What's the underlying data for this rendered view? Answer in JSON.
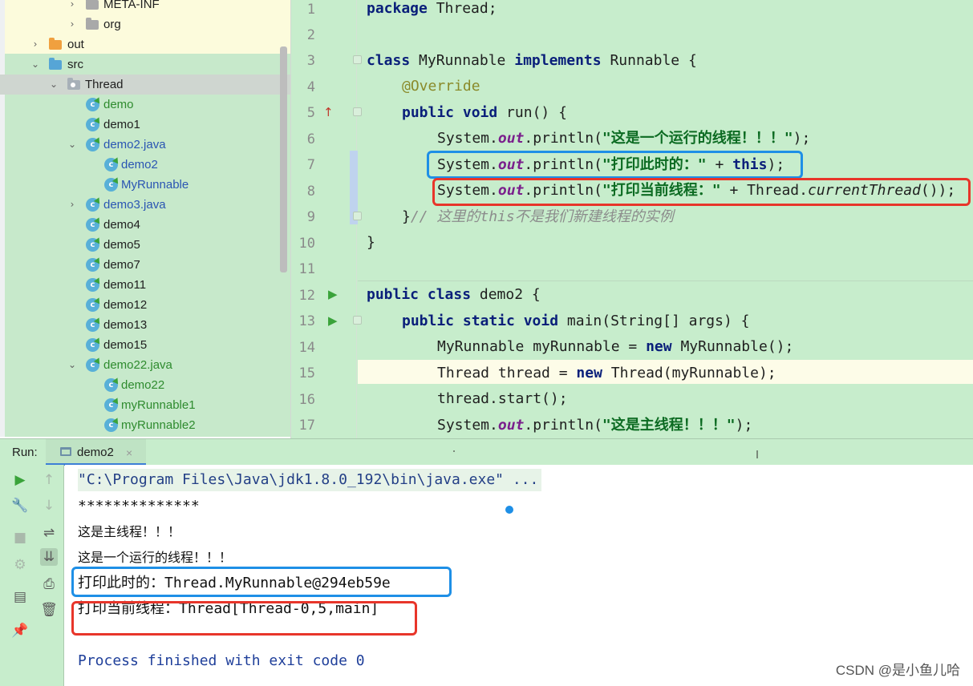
{
  "tree": {
    "items": [
      {
        "label": "META-INF",
        "chevron": "›"
      },
      {
        "label": "org",
        "chevron": "›"
      },
      {
        "label": "out",
        "chevron": "›"
      },
      {
        "label": "src",
        "chevron": "⌄"
      },
      {
        "label": "Thread",
        "chevron": "⌄"
      },
      {
        "label": "demo"
      },
      {
        "label": "demo1"
      },
      {
        "label": "demo2.java",
        "chevron": "⌄"
      },
      {
        "label": "demo2"
      },
      {
        "label": "MyRunnable"
      },
      {
        "label": "demo3.java",
        "chevron": "›"
      },
      {
        "label": "demo4"
      },
      {
        "label": "demo5"
      },
      {
        "label": "demo7"
      },
      {
        "label": "demo11"
      },
      {
        "label": "demo12"
      },
      {
        "label": "demo13"
      },
      {
        "label": "demo15"
      },
      {
        "label": "demo22.java",
        "chevron": "⌄"
      },
      {
        "label": "demo22"
      },
      {
        "label": "myRunnable1"
      },
      {
        "label": "myRunnable2"
      }
    ],
    "class_icon_letter": "c"
  },
  "editor": {
    "line_numbers": [
      "1",
      "2",
      "3",
      "4",
      "5",
      "6",
      "7",
      "8",
      "9",
      "10",
      "11",
      "12",
      "13",
      "14",
      "15",
      "16",
      "17"
    ],
    "code": {
      "l1_kw": "package",
      "l1_rest": " Thread;",
      "l3_kw1": "class",
      "l3_name": " MyRunnable ",
      "l3_kw2": "implements",
      "l3_rest": " Runnable {",
      "l4_ann": "@Override",
      "l5_kw": "public void",
      "l5_rest": " run() {",
      "l6_a": "System.",
      "l6_fld": "out",
      "l6_b": ".println(",
      "l6_str": "\"这是一个运行的线程！！！\"",
      "l6_c": ");",
      "l7_a": "System.",
      "l7_fld": "out",
      "l7_b": ".println(",
      "l7_str": "\"打印此时的：\"",
      "l7_c": " + ",
      "l7_kw": "this",
      "l7_d": ");",
      "l8_a": "System.",
      "l8_fld": "out",
      "l8_b": ".println(",
      "l8_str": "\"打印当前线程：\"",
      "l8_c": " + Thread.",
      "l8_it": "currentThread",
      "l8_d": "());",
      "l9_a": "}",
      "l9_cmt": "// 这里的this不是我们新建线程的实例",
      "l10": "}",
      "l12_kw": "public class",
      "l12_rest": " demo2 {",
      "l13_kw": "public static void",
      "l13_rest": " main(String[] args) {",
      "l14_a": "MyRunnable myRunnable = ",
      "l14_kw": "new",
      "l14_b": " MyRunnable();",
      "l15_a": "Thread thread = ",
      "l15_kw": "new",
      "l15_b": " Thread(myRunnable);",
      "l16": "thread.start();",
      "l17_a": "System.",
      "l17_fld": "out",
      "l17_b": ".println(",
      "l17_str": "\"这是主线程！！！\"",
      "l17_c": ");"
    },
    "gutter_marks": {
      "override": "↑",
      "run": "▶"
    }
  },
  "run": {
    "label": "Run:",
    "tab_title": "demo2",
    "tab_close": "×",
    "tools": {
      "rerun": "▶",
      "up": "↑",
      "wrench": "🔧",
      "down": "↓",
      "stop": "■",
      "wrap": "⇌",
      "debug": "⚙",
      "scroll_end": "⇊",
      "layout": "▤",
      "print": "⎙",
      "pin": "📌",
      "trash": "🗑"
    }
  },
  "console": {
    "lines": [
      "\"C:\\Program Files\\Java\\jdk1.8.0_192\\bin\\java.exe\" ...",
      "**************",
      "这是主线程！！！",
      "这是一个运行的线程！！！",
      "打印此时的：Thread.MyRunnable@294eb59e",
      "打印当前线程：Thread[Thread-0,5,main]",
      "",
      "Process finished with exit code 0"
    ]
  },
  "watermark": "CSDN @是小鱼儿哈",
  "colors": {
    "highlight_blue": "#1e8fe6",
    "highlight_red": "#e8352a",
    "editor_bg": "#c7edcc"
  }
}
